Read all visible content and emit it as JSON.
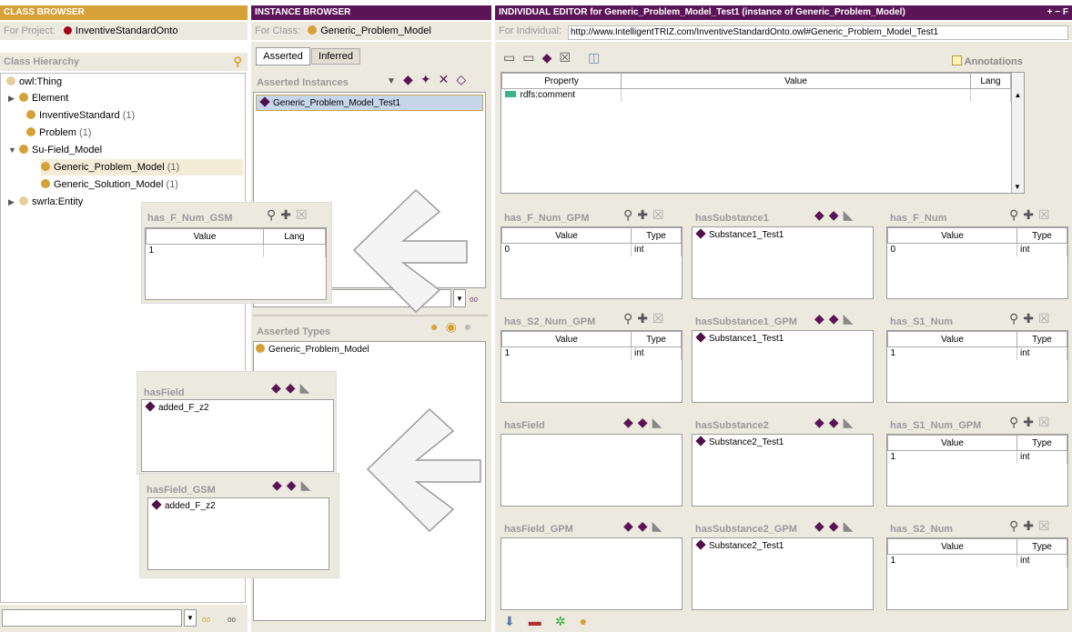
{
  "class_browser": {
    "title": "CLASS BROWSER",
    "project_label": "For Project:",
    "project_name": "InventiveStandardOnto",
    "hierarchy_label": "Class Hierarchy",
    "tree": [
      {
        "label": "owl:Thing",
        "count": ""
      },
      {
        "label": "Element",
        "count": ""
      },
      {
        "label": "InventiveStandard",
        "count": "(1)"
      },
      {
        "label": "Problem",
        "count": "(1)"
      },
      {
        "label": "Su-Field_Model",
        "count": ""
      },
      {
        "label": "Generic_Problem_Model",
        "count": "(1)"
      },
      {
        "label": "Generic_Solution_Model",
        "count": "(1)"
      },
      {
        "label": "swrla:Entity",
        "count": ""
      }
    ]
  },
  "instance_browser": {
    "title": "INSTANCE BROWSER",
    "for_class_label": "For Class:",
    "class_name": "Generic_Problem_Model",
    "tabs": [
      "Asserted",
      "Inferred"
    ],
    "asserted_instances_label": "Asserted Instances",
    "instances": [
      "Generic_Problem_Model_Test1"
    ],
    "asserted_types_label": "Asserted Types",
    "types": [
      "Generic_Problem_Model"
    ]
  },
  "individual_editor": {
    "title": "INDIVIDUAL EDITOR for Generic_Problem_Model_Test1  (instance of Generic_Problem_Model)",
    "title_controls": "+ − F",
    "for_individual_label": "For Individual:",
    "individual_uri": "http://www.IntelligentTRIZ.com/InventiveStandardOnto.owl#Generic_Problem_Model_Test1",
    "annotations_label": "Annotations",
    "columns": [
      "Property",
      "Value",
      "Lang"
    ],
    "rows": [
      {
        "property": "rdfs:comment",
        "value": "",
        "lang": ""
      }
    ]
  },
  "widgets": {
    "has_F_Num_GPM": {
      "title": "has_F_Num_GPM",
      "cols": [
        "Value",
        "Type"
      ],
      "value": "0",
      "type": "int"
    },
    "hasSubstance1": {
      "title": "hasSubstance1",
      "items": [
        "Substance1_Test1"
      ]
    },
    "has_F_Num": {
      "title": "has_F_Num",
      "cols": [
        "Value",
        "Type"
      ],
      "value": "0",
      "type": "int"
    },
    "has_S2_Num_GPM": {
      "title": "has_S2_Num_GPM",
      "cols": [
        "Value",
        "Type"
      ],
      "value": "1",
      "type": "int"
    },
    "hasSubstance1_GPM": {
      "title": "hasSubstance1_GPM",
      "items": [
        "Substance1_Test1"
      ]
    },
    "has_S1_Num": {
      "title": "has_S1_Num",
      "cols": [
        "Value",
        "Type"
      ],
      "value": "1",
      "type": "int"
    },
    "hasField": {
      "title": "hasField",
      "items": []
    },
    "hasSubstance2": {
      "title": "hasSubstance2",
      "items": [
        "Substance2_Test1"
      ]
    },
    "has_S1_Num_GPM": {
      "title": "has_S1_Num_GPM",
      "cols": [
        "Value",
        "Type"
      ],
      "value": "1",
      "type": "int"
    },
    "hasField_GPM": {
      "title": "hasField_GPM",
      "items": []
    },
    "hasSubstance2_GPM": {
      "title": "hasSubstance2_GPM",
      "items": [
        "Substance2_Test1"
      ]
    },
    "has_S2_Num": {
      "title": "has_S2_Num",
      "cols": [
        "Value",
        "Type"
      ],
      "value": "1",
      "type": "int"
    }
  },
  "overlays": {
    "has_F_Num_GSM": {
      "title": "has_F_Num_GSM",
      "cols": [
        "Value",
        "Lang"
      ],
      "value": "1"
    },
    "hasField_left": {
      "title": "hasField",
      "items": [
        "added_F_z2"
      ]
    },
    "hasField_GSM": {
      "title": "hasField_GSM",
      "items": [
        "added_F_z2"
      ]
    }
  }
}
